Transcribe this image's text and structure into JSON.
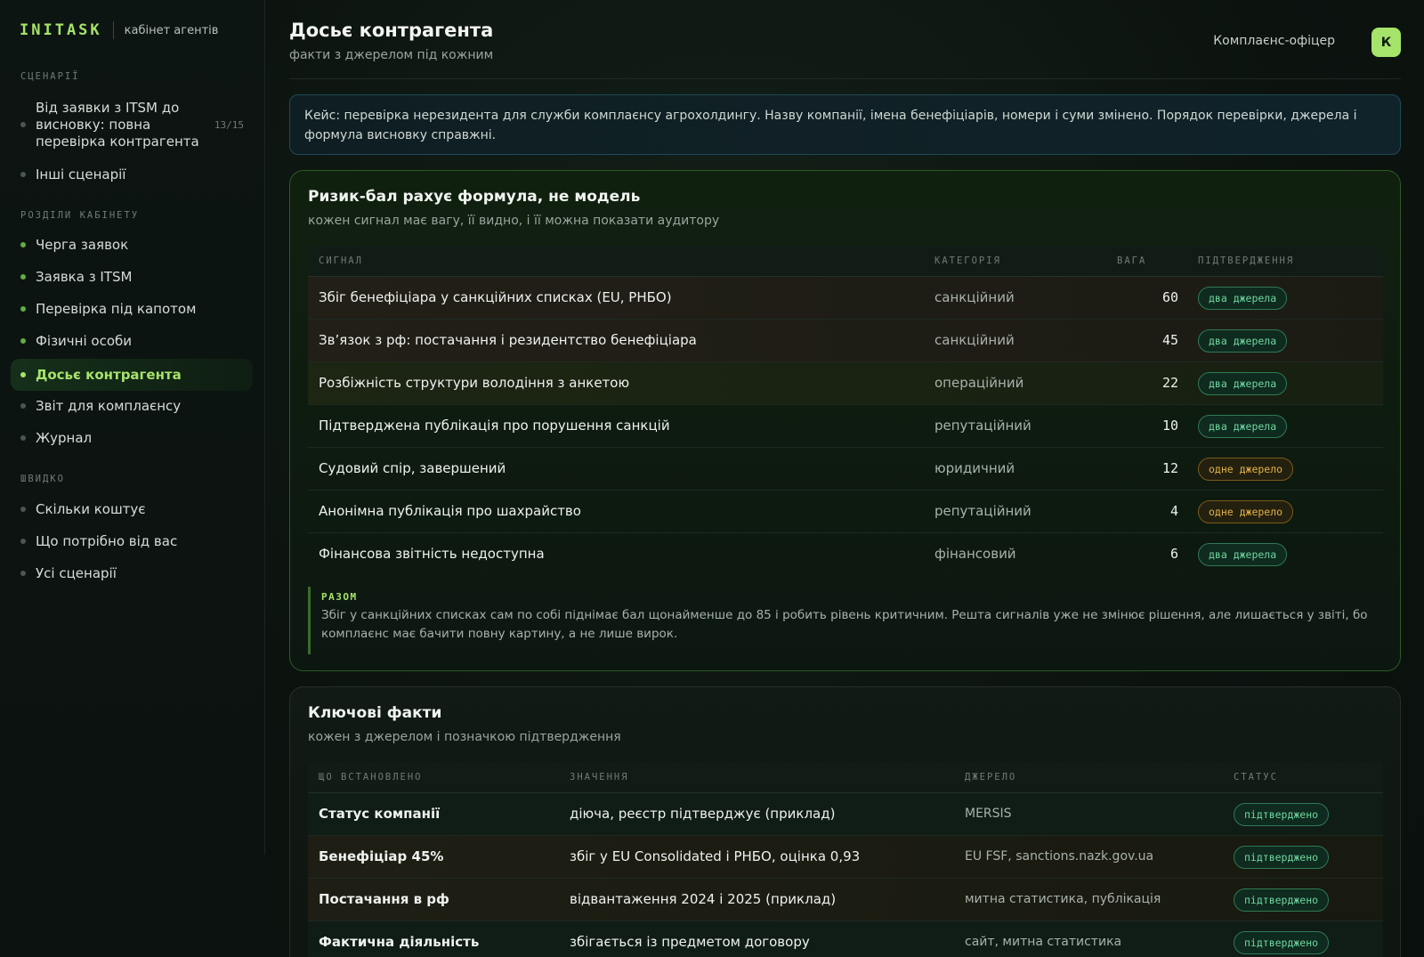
{
  "brand": {
    "logo": "INITASK",
    "subtitle": "кабінет агентів"
  },
  "sidebar": {
    "sections": [
      {
        "title": "СЦЕНАРІЇ"
      },
      {
        "title": "РОЗДІЛИ КАБІНЕТУ"
      },
      {
        "title": "ШВИДКО"
      }
    ],
    "scenarios": [
      {
        "label": "Від заявки з ITSM до висновку: повна перевірка контрагента",
        "count": "13/15"
      },
      {
        "label": "Інші сценарії"
      }
    ],
    "sections_items": [
      {
        "label": "Черга заявок"
      },
      {
        "label": "Заявка з ITSM"
      },
      {
        "label": "Перевірка під капотом"
      },
      {
        "label": "Фізичні особи"
      },
      {
        "label": "Досьє контрагента"
      },
      {
        "label": "Звіт для комплаєнсу"
      },
      {
        "label": "Журнал"
      }
    ],
    "quick_items": [
      {
        "label": "Скільки коштує"
      },
      {
        "label": "Що потрібно від вас"
      },
      {
        "label": "Усі сценарії"
      }
    ]
  },
  "header": {
    "title": "Досьє контрагента",
    "subtitle": "факти з джерелом під кожним",
    "user_role": "Комплаєнс-офіцер",
    "avatar_letter": "К"
  },
  "case_note": "Кейс: перевірка нерезидента для служби комплаєнсу агрохолдингу. Назву компанії, імена бенефіціарів, номери і суми змінено. Порядок перевірки, джерела і формула висновку справжні.",
  "risk_card": {
    "title": "Ризик-бал рахує формула, не модель",
    "subtitle": "кожен сигнал має вагу, її видно, і її можна показати аудитору",
    "columns": [
      "СИГНАЛ",
      "КАТЕГОРІЯ",
      "ВАГА",
      "ПІДТВЕРДЖЕННЯ"
    ],
    "rows": [
      {
        "signal": "Збіг бенефіціара у санкційних списках (EU, РНБО)",
        "category": "санкційний",
        "weight": "60",
        "confirmation": "два джерела"
      },
      {
        "signal": "Зв’язок з рф: постачання і резидентство бенефіціара",
        "category": "санкційний",
        "weight": "45",
        "confirmation": "два джерела"
      },
      {
        "signal": "Розбіжність структури володіння з анкетою",
        "category": "операційний",
        "weight": "22",
        "confirmation": "два джерела"
      },
      {
        "signal": "Підтверджена публікація про порушення санкцій",
        "category": "репутаційний",
        "weight": "10",
        "confirmation": "два джерела"
      },
      {
        "signal": "Судовий спір, завершений",
        "category": "юридичний",
        "weight": "12",
        "confirmation": "одне джерело"
      },
      {
        "signal": "Анонімна публікація про шахрайство",
        "category": "репутаційний",
        "weight": "4",
        "confirmation": "одне джерело"
      },
      {
        "signal": "Фінансова звітність недоступна",
        "category": "фінансовий",
        "weight": "6",
        "confirmation": "два джерела"
      }
    ],
    "summary_label": "РАЗОМ",
    "summary_text": "Збіг у санкційних списках сам по собі піднімає бал щонайменше до 85 і робить рівень критичним. Решта сигналів уже не змінює рішення, але лишається у звіті, бо комплаєнс має бачити повну картину, а не лише вирок."
  },
  "facts_card": {
    "title": "Ключові факти",
    "subtitle": "кожен з джерелом і позначкою підтвердження",
    "columns": [
      "ЩО ВСТАНОВЛЕНО",
      "ЗНАЧЕННЯ",
      "ДЖЕРЕЛО",
      "СТАТУС"
    ],
    "rows": [
      {
        "fact": "Статус компанії",
        "value": "діюча, реєстр підтверджує (приклад)",
        "source": "MERSIS",
        "status": "підтверджено"
      },
      {
        "fact": "Бенефіціар 45%",
        "value": "збіг у EU Consolidated і РНБО, оцінка 0,93",
        "source": "EU FSF, sanctions.nazk.gov.ua",
        "status": "підтверджено"
      },
      {
        "fact": "Постачання в рф",
        "value": "відвантаження 2024 і 2025 (приклад)",
        "source": "митна статистика, публікація",
        "status": "підтверджено"
      },
      {
        "fact": "Фактична діяльність",
        "value": "збігається із предметом договору",
        "source": "сайт, митна статистика",
        "status": "підтверджено"
      }
    ]
  },
  "colors": {
    "accent": "#a6e36a",
    "badge_green": "#6fd7a0",
    "badge_amber": "#e3b24a",
    "case_border": "#1e4a56"
  }
}
